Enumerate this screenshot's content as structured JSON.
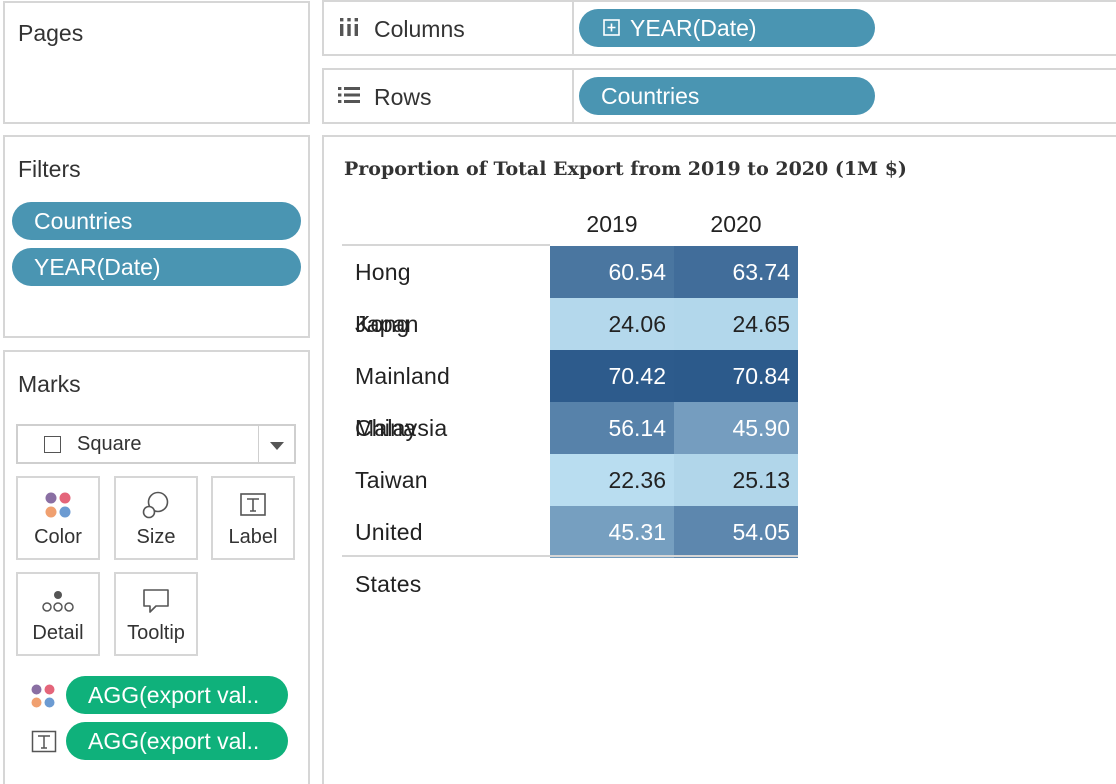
{
  "pages_card": {
    "title": "Pages"
  },
  "shelves": {
    "columns": {
      "label": "Columns",
      "pill": "YEAR(Date)"
    },
    "rows": {
      "label": "Rows",
      "pill": "Countries"
    }
  },
  "filters_card": {
    "title": "Filters",
    "pills": [
      "Countries",
      "YEAR(Date)"
    ]
  },
  "marks_card": {
    "title": "Marks",
    "mark_type": "Square",
    "buttons": [
      "Color",
      "Size",
      "Label",
      "Detail",
      "Tooltip"
    ],
    "fields": [
      {
        "encoding": "color",
        "label": "AGG(export val.."
      },
      {
        "encoding": "label",
        "label": "AGG(export val.."
      }
    ]
  },
  "view": {
    "title": "Proportion of Total Export from 2019 to 2020 (1M $)",
    "columns": [
      "2019",
      "2020"
    ],
    "rows": [
      {
        "country": "Hong Kong",
        "v2019": "60.54",
        "v2020": "63.74"
      },
      {
        "country": "Japan",
        "v2019": "24.06",
        "v2020": "24.65"
      },
      {
        "country": "Mainland China",
        "v2019": "70.42",
        "v2020": "70.84"
      },
      {
        "country": "Malaysia",
        "v2019": "56.14",
        "v2020": "45.90"
      },
      {
        "country": "Taiwan",
        "v2019": "22.36",
        "v2020": "25.13"
      },
      {
        "country": "United States",
        "v2019": "45.31",
        "v2020": "54.05"
      }
    ]
  },
  "chart_data": {
    "type": "heatmap",
    "title": "Proportion of Total Export from 2019 to 2020 (1M $)",
    "x": [
      "2019",
      "2020"
    ],
    "y": [
      "Hong Kong",
      "Japan",
      "Mainland China",
      "Malaysia",
      "Taiwan",
      "United States"
    ],
    "values": [
      [
        60.54,
        63.74
      ],
      [
        24.06,
        24.65
      ],
      [
        70.42,
        70.84
      ],
      [
        56.14,
        45.9
      ],
      [
        22.36,
        25.13
      ],
      [
        45.31,
        54.05
      ]
    ],
    "color_scale": [
      "#b9ddf0",
      "#2c5a8b"
    ]
  }
}
